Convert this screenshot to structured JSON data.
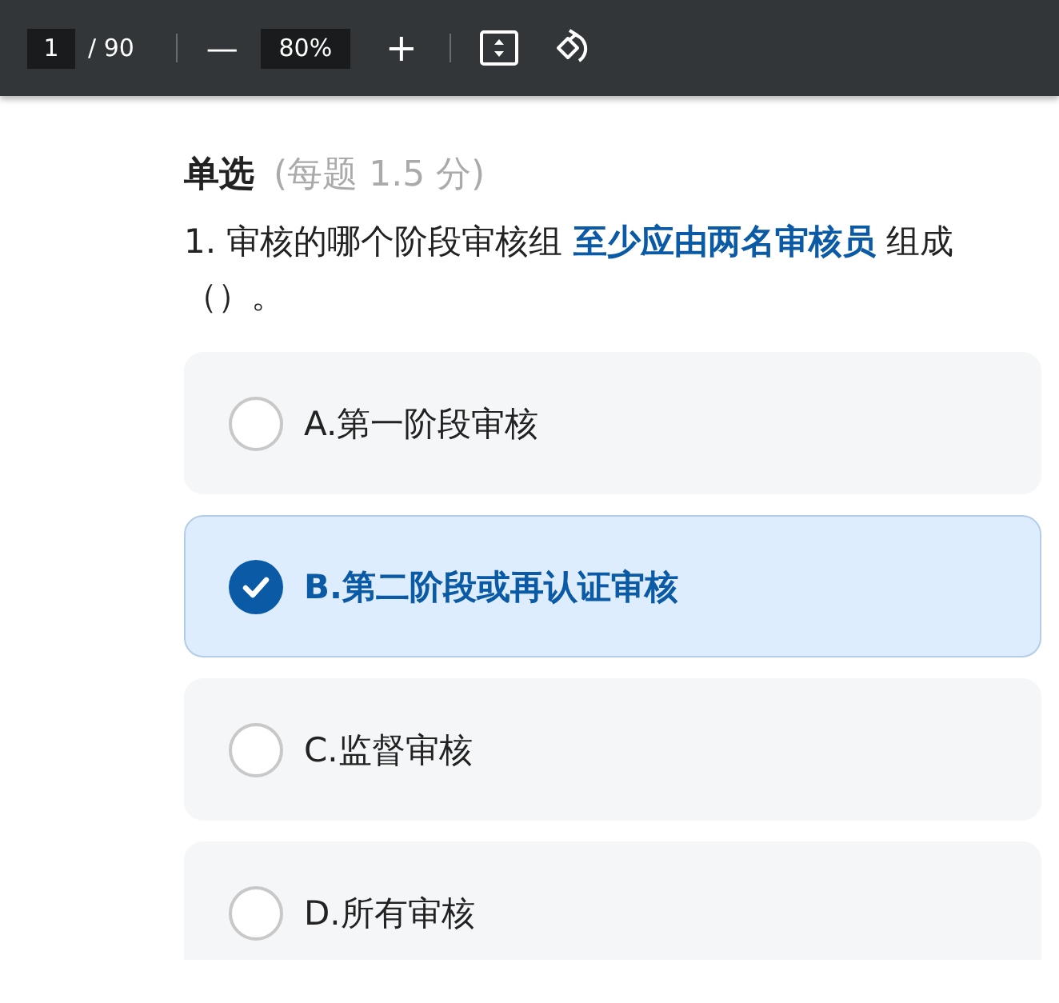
{
  "toolbar": {
    "page": "1",
    "page_total": "/ 90",
    "zoom_out": "—",
    "zoom": "80%",
    "zoom_in": "+"
  },
  "section": {
    "title": "单选",
    "note": "(每题 1.5 分)"
  },
  "question": {
    "text": "1. 审核的哪个阶段审核组 **至少应由两名审核员** 组成（）。"
  },
  "options": [
    {
      "label": "A.第一阶段审核",
      "selected": false
    },
    {
      "label": "B.第二阶段或再认证审核",
      "selected": true
    },
    {
      "label": "C.监督审核",
      "selected": false
    },
    {
      "label": "D.所有审核",
      "selected": false
    }
  ]
}
